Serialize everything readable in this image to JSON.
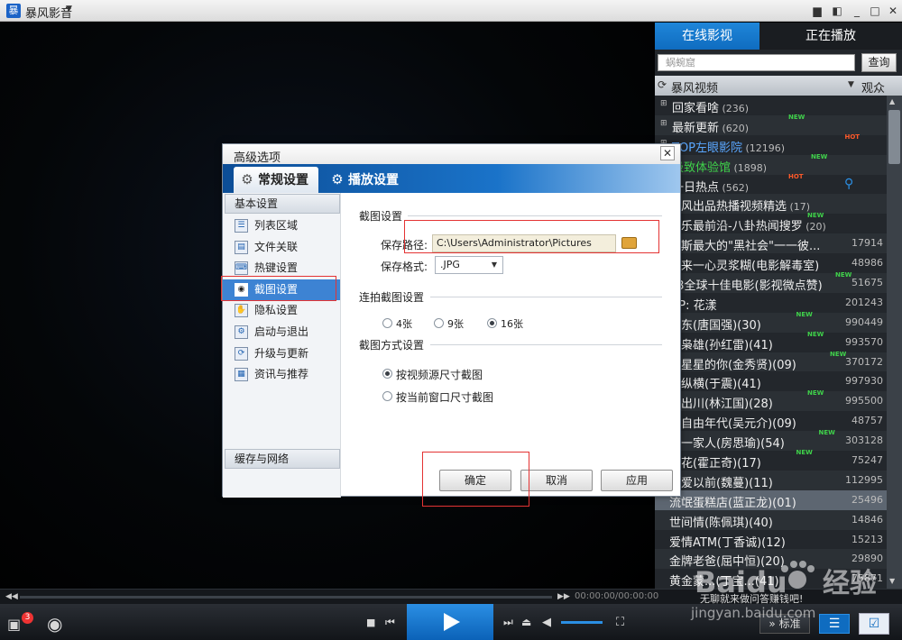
{
  "app": {
    "name": "暴风影音",
    "logo_glyph": "暴"
  },
  "window": {
    "min": "_",
    "max": "□",
    "close": "✕"
  },
  "panel": {
    "tab_online": "在线影视",
    "tab_playing": "正在播放",
    "search_placeholder": "蜗蜿窟",
    "search_button": "查询",
    "source_label": "暴风视频",
    "view_label": "观众",
    "items": [
      {
        "name": "回家看啥",
        "count": "(236)",
        "exp": "⊞",
        "badge": ""
      },
      {
        "name": "最新更新",
        "count": "(620)",
        "exp": "⊞",
        "badge": "NEW"
      },
      {
        "name": "TOP左眼影院",
        "count": "(12196)",
        "exp": "⊞",
        "badge": "HOT"
      },
      {
        "name": "极致体验馆",
        "count": "(1898)",
        "exp": "⊞",
        "badge": "NEW"
      },
      {
        "name": "一日热点",
        "count": "(562)",
        "exp": "⊟",
        "badge": "HOT"
      },
      {
        "name": "暴风出品热播视频精选",
        "count": "(17)",
        "exp": "",
        "badge": ""
      },
      {
        "name": "娱乐最前沿-八卦热闻搜罗",
        "count": "(20)",
        "exp": "",
        "badge": "NEW"
      },
      {
        "name": "罗斯最大的\"黑社会\"一一彼...",
        "count": "17914",
        "exp": "",
        "badge": ""
      },
      {
        "name": "风来一心灵浆糊(电影解毒室)",
        "count": "48986",
        "exp": "",
        "badge": ""
      },
      {
        "name": "13全球十佳电影(影视微点赞)",
        "count": "51675",
        "exp": "",
        "badge": "NEW"
      },
      {
        "name": "OP: 花漾",
        "count": "201243",
        "exp": "",
        "badge": ""
      },
      {
        "name": "泽东(唐国强)(30)",
        "count": "990449",
        "exp": "",
        "badge": "NEW"
      },
      {
        "name": "代枭雄(孙红雷)(41)",
        "count": "993570",
        "exp": "",
        "badge": "NEW"
      },
      {
        "name": "自星星的你(金秀贤)(09)",
        "count": "370172",
        "exp": "",
        "badge": "NEW"
      },
      {
        "name": "箭纵横(于震)(41)",
        "count": "997930",
        "exp": "",
        "badge": ""
      },
      {
        "name": "士出川(林江国)(28)",
        "count": "995500",
        "exp": "",
        "badge": "NEW"
      },
      {
        "name": "的自由年代(吴元介)(09)",
        "count": "48757",
        "exp": "",
        "badge": ""
      },
      {
        "name": "爱一家人(房思瑜)(54)",
        "count": "303128",
        "exp": "",
        "badge": "NEW"
      },
      {
        "name": "恋花(霍正奇)(17)",
        "count": "75247",
        "exp": "",
        "badge": "NEW"
      },
      {
        "name": "到爱以前(魏蔓)(11)",
        "count": "112995",
        "exp": "",
        "badge": ""
      },
      {
        "name": "流氓蛋糕店(蓝正龙)(01)",
        "count": "25496",
        "exp": "",
        "badge": ""
      },
      {
        "name": "世间情(陈佩琪)(40)",
        "count": "14846",
        "exp": "",
        "badge": ""
      },
      {
        "name": "爱情ATM(丁香诚)(12)",
        "count": "15213",
        "exp": "",
        "badge": ""
      },
      {
        "name": "金牌老爸(屈中恒)(20)",
        "count": "29890",
        "exp": "",
        "badge": ""
      },
      {
        "name": "黄金蒙...(丁宝...(41)",
        "count": "75871",
        "exp": "",
        "badge": ""
      }
    ]
  },
  "player": {
    "time": "00:00:00/00:00:00",
    "promo": "无聊就来做问答赚钱吧!",
    "box_badge": "3",
    "standard_label": "标准",
    "list_icon": "☰",
    "check_icon": "☑"
  },
  "dialog": {
    "title": "高级选项",
    "tab_general": "常规设置",
    "tab_playback": "播放设置",
    "side_head_basic": "基本设置",
    "side_items": [
      {
        "label": "列表区域",
        "glyph": "☰"
      },
      {
        "label": "文件关联",
        "glyph": "▤"
      },
      {
        "label": "热键设置",
        "glyph": "⌨"
      },
      {
        "label": "截图设置",
        "glyph": "◉"
      },
      {
        "label": "隐私设置",
        "glyph": "✋"
      },
      {
        "label": "启动与退出",
        "glyph": "⚙"
      },
      {
        "label": "升级与更新",
        "glyph": "⟳"
      },
      {
        "label": "资讯与推荐",
        "glyph": "▦"
      }
    ],
    "side_head_cache": "缓存与网络",
    "screenshot": {
      "section_title": "截图设置",
      "path_label": "保存路径:",
      "path_value": "C:\\Users\\Administrator\\Pictures",
      "format_label": "保存格式:",
      "format_value": ".JPG"
    },
    "burst": {
      "section_title": "连拍截图设置",
      "options": [
        "4张",
        "9张",
        "16张"
      ],
      "selected": "16张"
    },
    "mode": {
      "section_title": "截图方式设置",
      "opt_source": "按视频源尺寸截图",
      "opt_window": "按当前窗口尺寸截图",
      "selected": "按视频源尺寸截图"
    },
    "buttons": {
      "ok": "确定",
      "cancel": "取消",
      "apply": "应用"
    },
    "close_glyph": "✕"
  },
  "watermark": {
    "logo": "Baidu",
    "label": "经验",
    "url": "jingyan.baidu.com"
  }
}
